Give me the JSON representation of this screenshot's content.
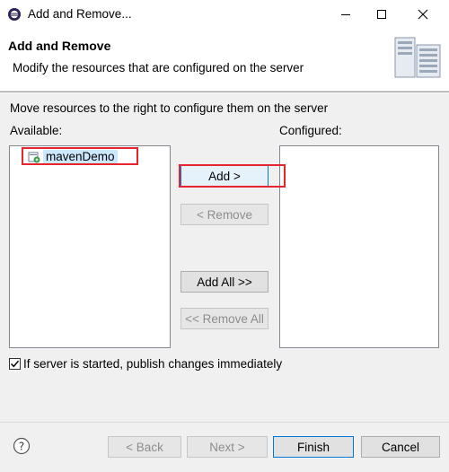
{
  "window": {
    "title": "Add and Remove...",
    "min_icon": "minimize-icon",
    "max_icon": "maximize-icon",
    "close_icon": "close-icon"
  },
  "header": {
    "title": "Add and Remove",
    "description": "Modify the resources that are configured on the server",
    "icon": "server-icon"
  },
  "main": {
    "instruction": "Move resources to the right to configure them on the server",
    "available_label": "Available:",
    "configured_label": "Configured:",
    "available_items": [
      {
        "label": "mavenDemo",
        "icon": "project-icon",
        "selected": true
      }
    ],
    "configured_items": []
  },
  "buttons": {
    "add": "Add >",
    "remove": "< Remove",
    "add_all": "Add All >>",
    "remove_all": "<< Remove All"
  },
  "options": {
    "publish_label": "If server is started, publish changes immediately",
    "publish_checked": true
  },
  "footer": {
    "back": "< Back",
    "next": "Next >",
    "finish": "Finish",
    "cancel": "Cancel",
    "help_icon": "help-icon"
  },
  "colors": {
    "highlight": "#e8242e",
    "selection": "#cce8ff",
    "accent": "#0078d7"
  }
}
